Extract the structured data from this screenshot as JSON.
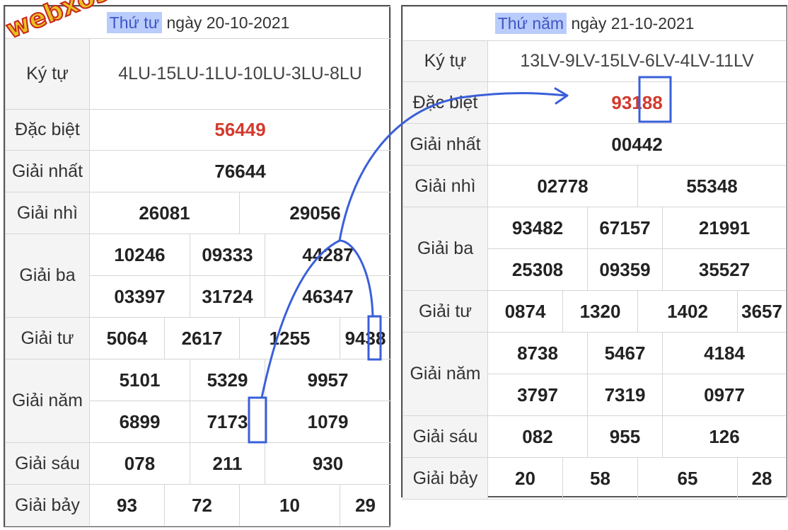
{
  "watermark": "webxoso.net",
  "left": {
    "header": {
      "prefix_highlight": "Thứ tư",
      "suffix": " ngày 20-10-2021"
    },
    "kytu": {
      "label": "Ký tự",
      "value": "4LU-15LU-1LU-10LU-3LU-8LU"
    },
    "special": {
      "label": "Đặc biệt",
      "value": "56449"
    },
    "prize1": {
      "label": "Giải nhất",
      "values": [
        "76644"
      ]
    },
    "prize2": {
      "label": "Giải nhì",
      "values": [
        "26081",
        "29056"
      ]
    },
    "prize3": {
      "label": "Giải ba",
      "values": [
        "10246",
        "09333",
        "44287",
        "03397",
        "31724",
        "46347"
      ]
    },
    "prize4": {
      "label": "Giải tư",
      "values": [
        "5064",
        "2617",
        "1255",
        "9438"
      ]
    },
    "prize5": {
      "label": "Giải năm",
      "values": [
        "5101",
        "5329",
        "9957",
        "6899",
        "7173",
        "1079"
      ]
    },
    "prize6": {
      "label": "Giải sáu",
      "values": [
        "078",
        "211",
        "930"
      ]
    },
    "prize7": {
      "label": "Giải bảy",
      "values": [
        "93",
        "72",
        "10",
        "29"
      ]
    }
  },
  "right": {
    "header": {
      "prefix_highlight": "Thứ năm",
      "suffix": " ngày 21-10-2021"
    },
    "kytu": {
      "label": "Ký tự",
      "value": "13LV-9LV-15LV-6LV-4LV-11LV"
    },
    "special": {
      "label": "Đặc biệt",
      "value": "93188"
    },
    "prize1": {
      "label": "Giải nhất",
      "values": [
        "00442"
      ]
    },
    "prize2": {
      "label": "Giải nhì",
      "values": [
        "02778",
        "55348"
      ]
    },
    "prize3": {
      "label": "Giải ba",
      "values": [
        "93482",
        "67157",
        "21991",
        "25308",
        "09359",
        "35527"
      ]
    },
    "prize4": {
      "label": "Giải tư",
      "values": [
        "0874",
        "1320",
        "1402",
        "3657"
      ]
    },
    "prize5": {
      "label": "Giải năm",
      "values": [
        "8738",
        "5467",
        "4184",
        "3797",
        "7319",
        "0977"
      ]
    },
    "prize6": {
      "label": "Giải sáu",
      "values": [
        "082",
        "955",
        "126"
      ]
    },
    "prize7": {
      "label": "Giải bảy",
      "values": [
        "20",
        "58",
        "65",
        "28"
      ]
    }
  },
  "colors": {
    "special_red": "#d23a2d",
    "highlight_box": "#3a5fd9",
    "header_highlight_bg": "#b9ccfb",
    "watermark_fill": "#e8c020",
    "watermark_stroke": "#c8261a"
  }
}
